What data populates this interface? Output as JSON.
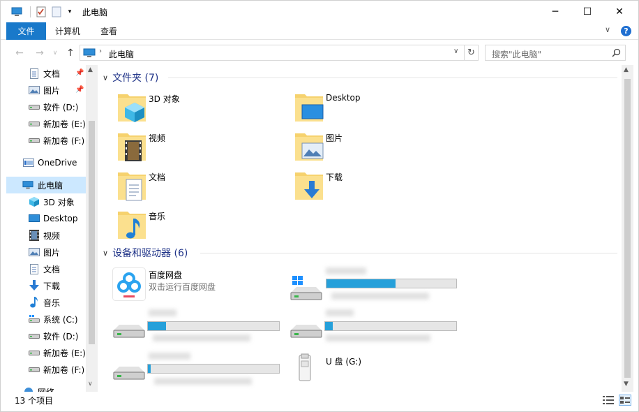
{
  "window": {
    "title": "此电脑",
    "controls": {
      "minimize": "─",
      "maximize": "☐",
      "close": "✕"
    }
  },
  "ribbon": {
    "tabs": [
      "文件",
      "计算机",
      "查看"
    ],
    "help": "?"
  },
  "address": {
    "path": "此电脑",
    "search_placeholder": "搜索\"此电脑\""
  },
  "nav_pane": {
    "items": [
      {
        "label": "文档",
        "icon": "documents-icon",
        "pinned": true
      },
      {
        "label": "图片",
        "icon": "pictures-icon",
        "pinned": true
      },
      {
        "label": "软件 (D:)",
        "icon": "drive-icon"
      },
      {
        "label": "新加卷 (E:)",
        "icon": "drive-icon"
      },
      {
        "label": "新加卷 (F:)",
        "icon": "drive-icon"
      },
      {
        "label": "OneDrive",
        "icon": "onedrive-icon"
      },
      {
        "label": "此电脑",
        "icon": "this-pc-icon",
        "selected": true
      },
      {
        "label": "3D 对象",
        "icon": "3d-objects-icon"
      },
      {
        "label": "Desktop",
        "icon": "desktop-icon"
      },
      {
        "label": "视频",
        "icon": "videos-icon"
      },
      {
        "label": "图片",
        "icon": "pictures-icon"
      },
      {
        "label": "文档",
        "icon": "documents-icon"
      },
      {
        "label": "下载",
        "icon": "downloads-icon"
      },
      {
        "label": "音乐",
        "icon": "music-icon"
      },
      {
        "label": "系统 (C:)",
        "icon": "system-drive-icon"
      },
      {
        "label": "软件 (D:)",
        "icon": "drive-icon"
      },
      {
        "label": "新加卷 (E:)",
        "icon": "drive-icon"
      },
      {
        "label": "新加卷 (F:)",
        "icon": "drive-icon"
      },
      {
        "label": "网络",
        "icon": "network-icon"
      }
    ]
  },
  "folders_group": {
    "title": "文件夹 (7)",
    "items": [
      {
        "label": "3D 对象",
        "icon": "3d-objects-icon"
      },
      {
        "label": "Desktop",
        "icon": "desktop-icon"
      },
      {
        "label": "视频",
        "icon": "videos-icon"
      },
      {
        "label": "图片",
        "icon": "pictures-icon"
      },
      {
        "label": "文档",
        "icon": "documents-icon"
      },
      {
        "label": "下载",
        "icon": "downloads-icon"
      },
      {
        "label": "音乐",
        "icon": "music-icon"
      }
    ]
  },
  "devices_group": {
    "title": "设备和驱动器 (6)",
    "items": [
      {
        "label": "百度网盘",
        "subtitle": "双击运行百度网盘",
        "icon": "baidu-netdisk-icon"
      },
      {
        "label": "",
        "icon": "system-drive-icon",
        "usage": 0.53
      },
      {
        "label": "",
        "icon": "drive-icon",
        "usage": 0.14
      },
      {
        "label": "",
        "icon": "drive-icon",
        "usage": 0.06
      },
      {
        "label": "",
        "icon": "drive-icon",
        "usage": 0.02
      },
      {
        "label": "U 盘 (G:)",
        "icon": "usb-drive-icon"
      }
    ]
  },
  "status": {
    "count": "13 个项目"
  },
  "colors": {
    "accent": "#1979ca",
    "selection": "#cce8ff",
    "bar_fill": "#26a0da",
    "group_title": "#1e3287"
  }
}
